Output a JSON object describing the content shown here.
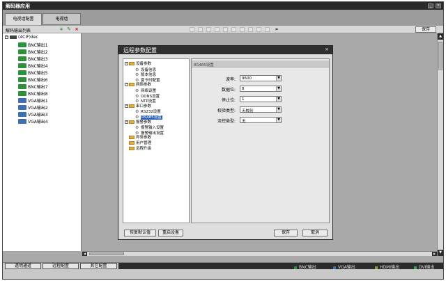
{
  "app": {
    "title": "解码器应用"
  },
  "tabs": [
    {
      "label": "电视墙配置"
    },
    {
      "label": "电视墙"
    }
  ],
  "toolbar": {
    "list_label": "解码输出列表",
    "expand_label": "»",
    "save_label": "保存"
  },
  "tree": {
    "root_label": "(4CIF)dec",
    "channels": [
      {
        "label": "BNC输出1",
        "kind": "bnc"
      },
      {
        "label": "BNC输出2",
        "kind": "bnc"
      },
      {
        "label": "BNC输出3",
        "kind": "bnc"
      },
      {
        "label": "BNC输出4",
        "kind": "bnc"
      },
      {
        "label": "BNC输出5",
        "kind": "bnc"
      },
      {
        "label": "BNC输出6",
        "kind": "bnc"
      },
      {
        "label": "BNC输出7",
        "kind": "bnc"
      },
      {
        "label": "BNC输出8",
        "kind": "bnc"
      },
      {
        "label": "VGA输出1",
        "kind": "vga"
      },
      {
        "label": "VGA输出2",
        "kind": "vga"
      },
      {
        "label": "VGA输出3",
        "kind": "vga"
      },
      {
        "label": "VGA输出4",
        "kind": "vga"
      }
    ]
  },
  "dialog": {
    "title": "远程参数配置",
    "close": "×",
    "tree": [
      {
        "label": "设备参数",
        "level": 0,
        "type": "folder",
        "expander": "−"
      },
      {
        "label": "设备信息",
        "level": 1,
        "type": "leaf"
      },
      {
        "label": "版本信息",
        "level": 1,
        "type": "leaf"
      },
      {
        "label": "夏令时配置",
        "level": 1,
        "type": "leaf"
      },
      {
        "label": "网络参数",
        "level": 0,
        "type": "folder",
        "expander": "−"
      },
      {
        "label": "网络设置",
        "level": 1,
        "type": "leaf"
      },
      {
        "label": "DDNS设置",
        "level": 1,
        "type": "leaf"
      },
      {
        "label": "NTP设置",
        "level": 1,
        "type": "leaf"
      },
      {
        "label": "串口参数",
        "level": 0,
        "type": "folder",
        "expander": "−"
      },
      {
        "label": "RS232设置",
        "level": 1,
        "type": "leaf"
      },
      {
        "label": "RS485设置",
        "level": 1,
        "type": "leaf",
        "selected": true
      },
      {
        "label": "报警参数",
        "level": 0,
        "type": "folder",
        "expander": "−"
      },
      {
        "label": "报警输入设置",
        "level": 1,
        "type": "leaf"
      },
      {
        "label": "报警输出设置",
        "level": 1,
        "type": "leaf"
      },
      {
        "label": "异常参数",
        "level": 0,
        "type": "folder"
      },
      {
        "label": "用户管理",
        "level": 0,
        "type": "folder"
      },
      {
        "label": "远程升级",
        "level": 0,
        "type": "folder"
      }
    ],
    "panel_title": "RS485设置",
    "fields": [
      {
        "label": "波率:",
        "value": "9600"
      },
      {
        "label": "数据位:",
        "value": "8"
      },
      {
        "label": "停止位:",
        "value": "1"
      },
      {
        "label": "校验类型:",
        "value": "无校验"
      },
      {
        "label": "流控类型:",
        "value": "无"
      }
    ],
    "buttons": {
      "restore": "恢复默认值",
      "reboot": "重启设备",
      "save": "保存",
      "cancel": "取消"
    }
  },
  "status": {
    "buttons": [
      {
        "label": "透明通道"
      },
      {
        "label": "远程配置"
      },
      {
        "label": "其它配置"
      }
    ],
    "legend": [
      {
        "label": "BNC输出",
        "color": "#2f8f3a"
      },
      {
        "label": "VGA输出",
        "color": "#3f6fb0"
      },
      {
        "label": "HDMI输出",
        "color": "#8a9a3a"
      },
      {
        "label": "DVI输出",
        "color": "#3aa060"
      }
    ]
  }
}
